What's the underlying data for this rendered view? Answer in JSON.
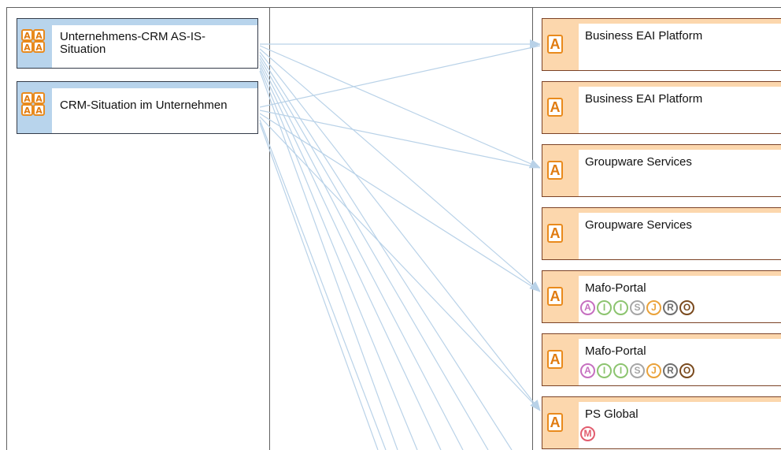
{
  "sources": [
    {
      "label": "Unternehmens-CRM AS-IS-Situation"
    },
    {
      "label": "CRM-Situation im Unternehmen"
    }
  ],
  "targets": [
    {
      "label": "Business EAI Platform",
      "icon": "A",
      "badges": []
    },
    {
      "label": "Business EAI Platform",
      "icon": "A",
      "badges": []
    },
    {
      "label": "Groupware Services",
      "icon": "A",
      "badges": []
    },
    {
      "label": "Groupware Services",
      "icon": "A",
      "badges": []
    },
    {
      "label": "Mafo-Portal",
      "icon": "A",
      "badges": [
        {
          "letter": "A",
          "color": "#c66fc0"
        },
        {
          "letter": "I",
          "color": "#8cc46f"
        },
        {
          "letter": "I",
          "color": "#8cc46f"
        },
        {
          "letter": "S",
          "color": "#a6a6a6"
        },
        {
          "letter": "J",
          "color": "#eaa23a"
        },
        {
          "letter": "R",
          "color": "#6f6f6f"
        },
        {
          "letter": "O",
          "color": "#7a4a1e"
        }
      ]
    },
    {
      "label": "Mafo-Portal",
      "icon": "A",
      "badges": [
        {
          "letter": "A",
          "color": "#c66fc0"
        },
        {
          "letter": "I",
          "color": "#8cc46f"
        },
        {
          "letter": "I",
          "color": "#8cc46f"
        },
        {
          "letter": "S",
          "color": "#a6a6a6"
        },
        {
          "letter": "J",
          "color": "#eaa23a"
        },
        {
          "letter": "R",
          "color": "#6f6f6f"
        },
        {
          "letter": "O",
          "color": "#7a4a1e"
        }
      ]
    },
    {
      "label": "PS Global",
      "icon": "A",
      "badges": [
        {
          "letter": "M",
          "color": "#e25c6e"
        }
      ]
    }
  ],
  "colors": {
    "source_fill": "#b8d4ec",
    "source_border": "#333b49",
    "target_fill": "#fcd7ad",
    "target_border": "#7b4226",
    "connector": "#b9d2e8",
    "icon_orange": "#e98a1c"
  }
}
